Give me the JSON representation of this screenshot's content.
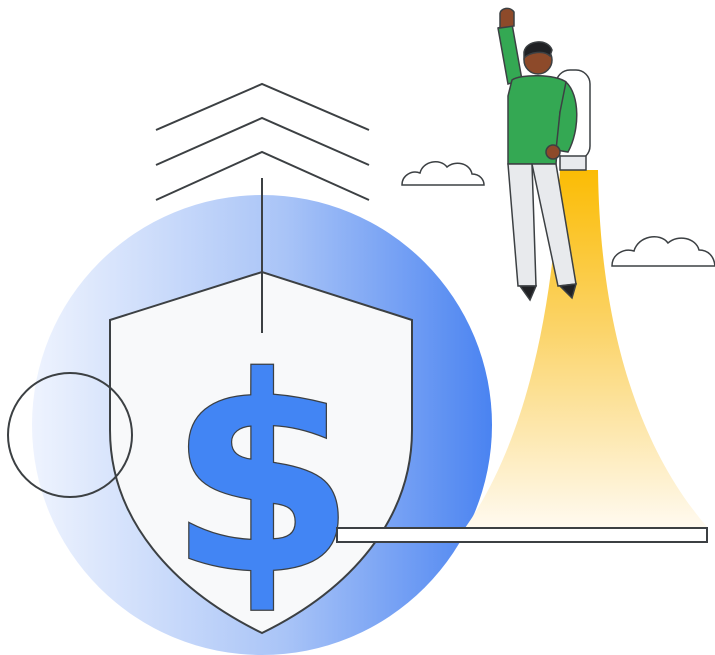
{
  "illustration": {
    "currency_symbol": "$",
    "icons": [
      "shield-icon",
      "dollar-icon",
      "chevron-up-icon",
      "cloud-icon",
      "person-icon",
      "jetpack-icon"
    ],
    "colors": {
      "background": "#ffffff",
      "circle_light": "#e8f0fe",
      "circle_dark": "#4c85f2",
      "shield_fill": "#f8f9fa",
      "outline": "#3c4043",
      "dollar_fill": "#4285f4",
      "flame_top": "#fbbc04",
      "flame_bottom": "#fefaf0",
      "shirt": "#34a853",
      "pants": "#e8eaed",
      "skin": "#8d4a2a",
      "hair": "#202124"
    }
  }
}
